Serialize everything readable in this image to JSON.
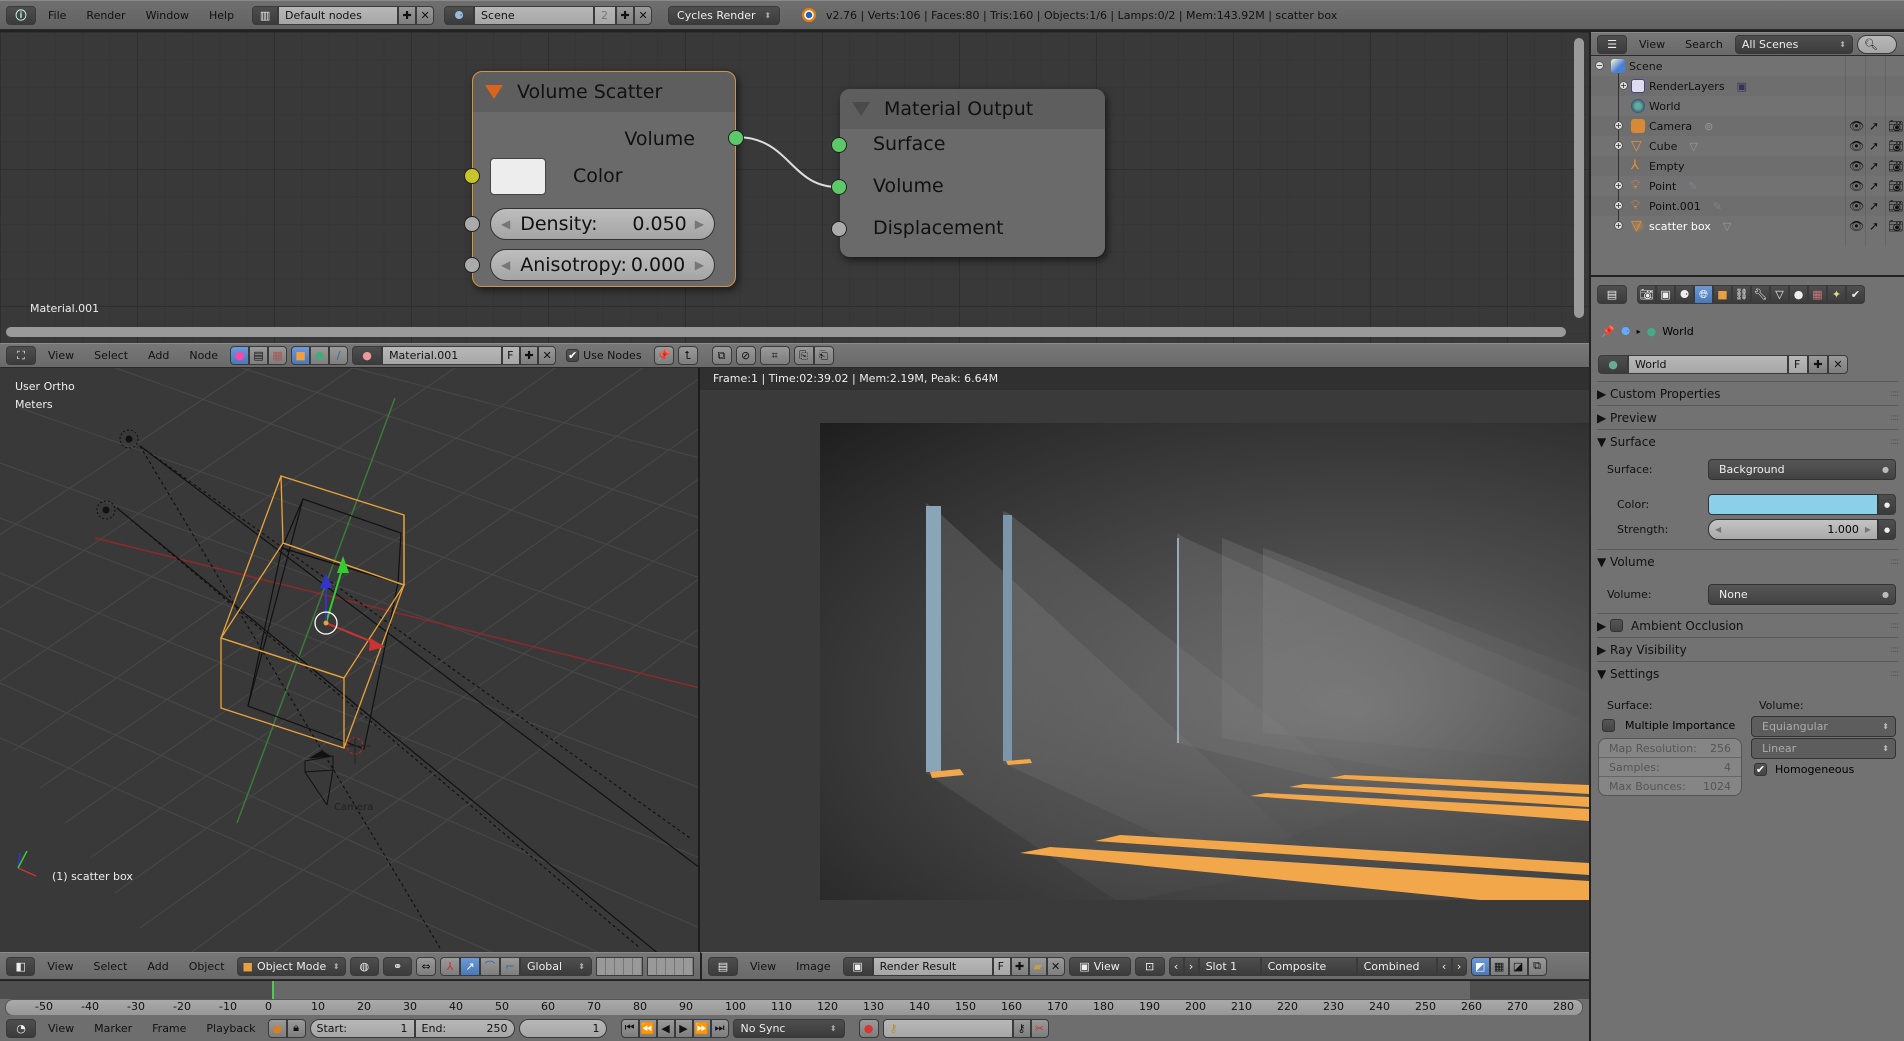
{
  "topbar": {
    "menus": [
      "File",
      "Render",
      "Window",
      "Help"
    ],
    "screen_layout": "Default nodes",
    "scene": "Scene",
    "scene_users": "2",
    "render_engine": "Cycles Render",
    "stats": "v2.76 | Verts:106 | Faces:80 | Tris:160 | Objects:1/6 | Lamps:0/2 | Mem:143.92M | scatter box"
  },
  "node_editor": {
    "material_label": "Material.001",
    "nodes": {
      "volume_scatter": {
        "title": "Volume Scatter",
        "output": "Volume",
        "color_label": "Color",
        "color_value": "#ededed",
        "density_label": "Density:",
        "density_value": "0.050",
        "anisotropy_label": "Anisotropy:",
        "anisotropy_value": "0.000"
      },
      "material_output": {
        "title": "Material Output",
        "inputs": [
          "Surface",
          "Volume",
          "Displacement"
        ]
      }
    },
    "header": {
      "menus": [
        "View",
        "Select",
        "Add",
        "Node"
      ],
      "material": "Material.001",
      "fake_user": "F",
      "use_nodes_label": "Use Nodes",
      "use_nodes": true
    }
  },
  "viewport_3d": {
    "view_name": "User Ortho",
    "units": "Meters",
    "camera_label": "Camera",
    "active_object": "(1) scatter box",
    "header": {
      "menus": [
        "View",
        "Select",
        "Add",
        "Object"
      ],
      "mode": "Object Mode",
      "orientation": "Global"
    }
  },
  "image_editor": {
    "render_info": "Frame:1 | Time:02:39.02 | Mem:2.19M, Peak: 6.64M",
    "header": {
      "menus": [
        "View",
        "Image"
      ],
      "image": "Render Result",
      "fake_user": "F",
      "view": "View",
      "slot": "Slot 1",
      "layer": "Composite",
      "pass": "Combined"
    }
  },
  "timeline": {
    "ticks": [
      -50,
      -40,
      -30,
      -20,
      -10,
      0,
      10,
      20,
      30,
      40,
      50,
      60,
      70,
      80,
      90,
      100,
      110,
      120,
      130,
      140,
      150,
      160,
      170,
      180,
      190,
      200,
      210,
      220,
      230,
      240,
      250,
      260,
      270,
      280
    ],
    "current_frame": 1,
    "menus": [
      "View",
      "Marker",
      "Frame",
      "Playback"
    ],
    "start_label": "Start:",
    "start": "1",
    "end_label": "End:",
    "end": "250",
    "frame": "1",
    "sync": "No Sync"
  },
  "outliner": {
    "menus": [
      "View",
      "Search"
    ],
    "filter": "All Scenes",
    "items": [
      {
        "name": "Scene",
        "type": "scene"
      },
      {
        "name": "RenderLayers",
        "type": "renderlayers"
      },
      {
        "name": "World",
        "type": "world"
      },
      {
        "name": "Camera",
        "type": "camera"
      },
      {
        "name": "Cube",
        "type": "mesh"
      },
      {
        "name": "Empty",
        "type": "empty"
      },
      {
        "name": "Point",
        "type": "lamp"
      },
      {
        "name": "Point.001",
        "type": "lamp"
      },
      {
        "name": "scatter box",
        "type": "mesh"
      }
    ]
  },
  "properties": {
    "breadcrumb": "World",
    "world_name": "World",
    "fake_user": "F",
    "panels": {
      "custom_properties": "Custom Properties",
      "preview": "Preview",
      "surface": "Surface",
      "volume": "Volume",
      "ambient_occlusion": "Ambient Occlusion",
      "ray_visibility": "Ray Visibility",
      "settings": "Settings"
    },
    "surface": {
      "surface_label": "Surface:",
      "surface_value": "Background",
      "color_label": "Color:",
      "color_value": "#8ccfe9",
      "strength_label": "Strength:",
      "strength_value": "1.000"
    },
    "volume": {
      "volume_label": "Volume:",
      "volume_value": "None"
    },
    "settings": {
      "surface_col": "Surface:",
      "volume_col": "Volume:",
      "multiple_importance_label": "Multiple Importance",
      "multiple_importance": false,
      "map_resolution_label": "Map Resolution:",
      "map_resolution": "256",
      "samples_label": "Samples:",
      "samples": "4",
      "max_bounces_label": "Max Bounces:",
      "max_bounces": "1024",
      "sampling": "Equiangular",
      "interpolation": "Linear",
      "homogeneous_label": "Homogeneous",
      "homogeneous": true
    }
  }
}
